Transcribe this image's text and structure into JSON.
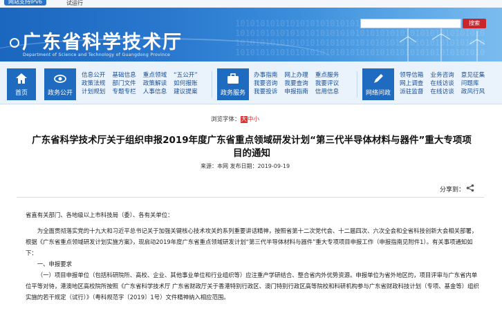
{
  "topbar": {
    "ipv6": "网站支持IPv6",
    "trial": "试运行"
  },
  "header": {
    "title": "广东省科学技术厅",
    "subtitle": "Department of Science and Technology of Guangdong Province",
    "binary": "10101010101010101010101010101010101010101010101010",
    "search_button": "搜索",
    "search_placeholder": ""
  },
  "nav": {
    "home": "首页",
    "affairs": {
      "label": "政务公开",
      "rows": [
        [
          "信息公开",
          "基础信息",
          "重点领域",
          "“五公开”"
        ],
        [
          "政策法规",
          "部门文件",
          "政策解读",
          "如何报账"
        ],
        [
          "计划规划",
          "专题专栏",
          "人事信息",
          "建议提案"
        ]
      ]
    },
    "services": {
      "label": "政务服务",
      "rows": [
        [
          "办事指南",
          "网上办理",
          "重点服务"
        ],
        [
          "我要咨询",
          "我要查询",
          "我要评议"
        ],
        [
          "我要投诉",
          "申报指南",
          "信用信息"
        ]
      ]
    },
    "interaction": {
      "label": "网络问政",
      "rows": [
        [
          "领导信箱",
          "业务咨询",
          "意见征集"
        ],
        [
          "网上调查",
          "在线访谈",
          "问题库"
        ],
        [
          "派驻监督",
          "在线访谈",
          "政风行风"
        ]
      ]
    }
  },
  "article": {
    "font_size_label": "浏览字体：",
    "font_size_large": "大",
    "font_size_medium": "中",
    "font_size_small": "小",
    "title": "广东省科学技术厅关于组织申报2019年度广东省重点领域研发计划“第三代半导体材料与器件”重大专项项目的通知",
    "meta": "来源：本网    发布日期：2019-09-19",
    "share": "分享到：",
    "salutation": "省直有关部门、各地级以上市科技局（委）、各有关单位：",
    "para1": "为全面贯彻落实党的十九大和习近平总书记关于加强关键核心技术攻关的系列重要讲话精神，按照省第十二次党代会、十二届四次、六次全会和全省科技创新大会相关部署，根据《广东省重点领域研发计划实施方案》，现启动2019年度广东省重点领域研发计划“第三代半导体材料与器件”重大专项项目申报工作（申报指南见附件1）。有关事项通知如下：",
    "section1": "一、申报要求",
    "para2": "（一）项目申报单位（包括科研院所、高校、企业、其他事业单位和行业组织等）应注重产学研结合、整合省内外优势资源。申报单位为省外地区的，项目评审与广东省内单位平等对待，港澳地区高校院所按照《广东省科学技术厅 广东省财政厅关于香港特别行政区、澳门特别行政区高等院校和科研机构参与广东省财政科技计划（专项、基金等）组织实施的若干规定（试行）》（粤科规范字〔2019〕1号）文件精神纳入相应范围。"
  },
  "colors": {
    "banner": "#1f6bc0",
    "accent_red": "#e3302f",
    "link": "#1a4f96"
  }
}
